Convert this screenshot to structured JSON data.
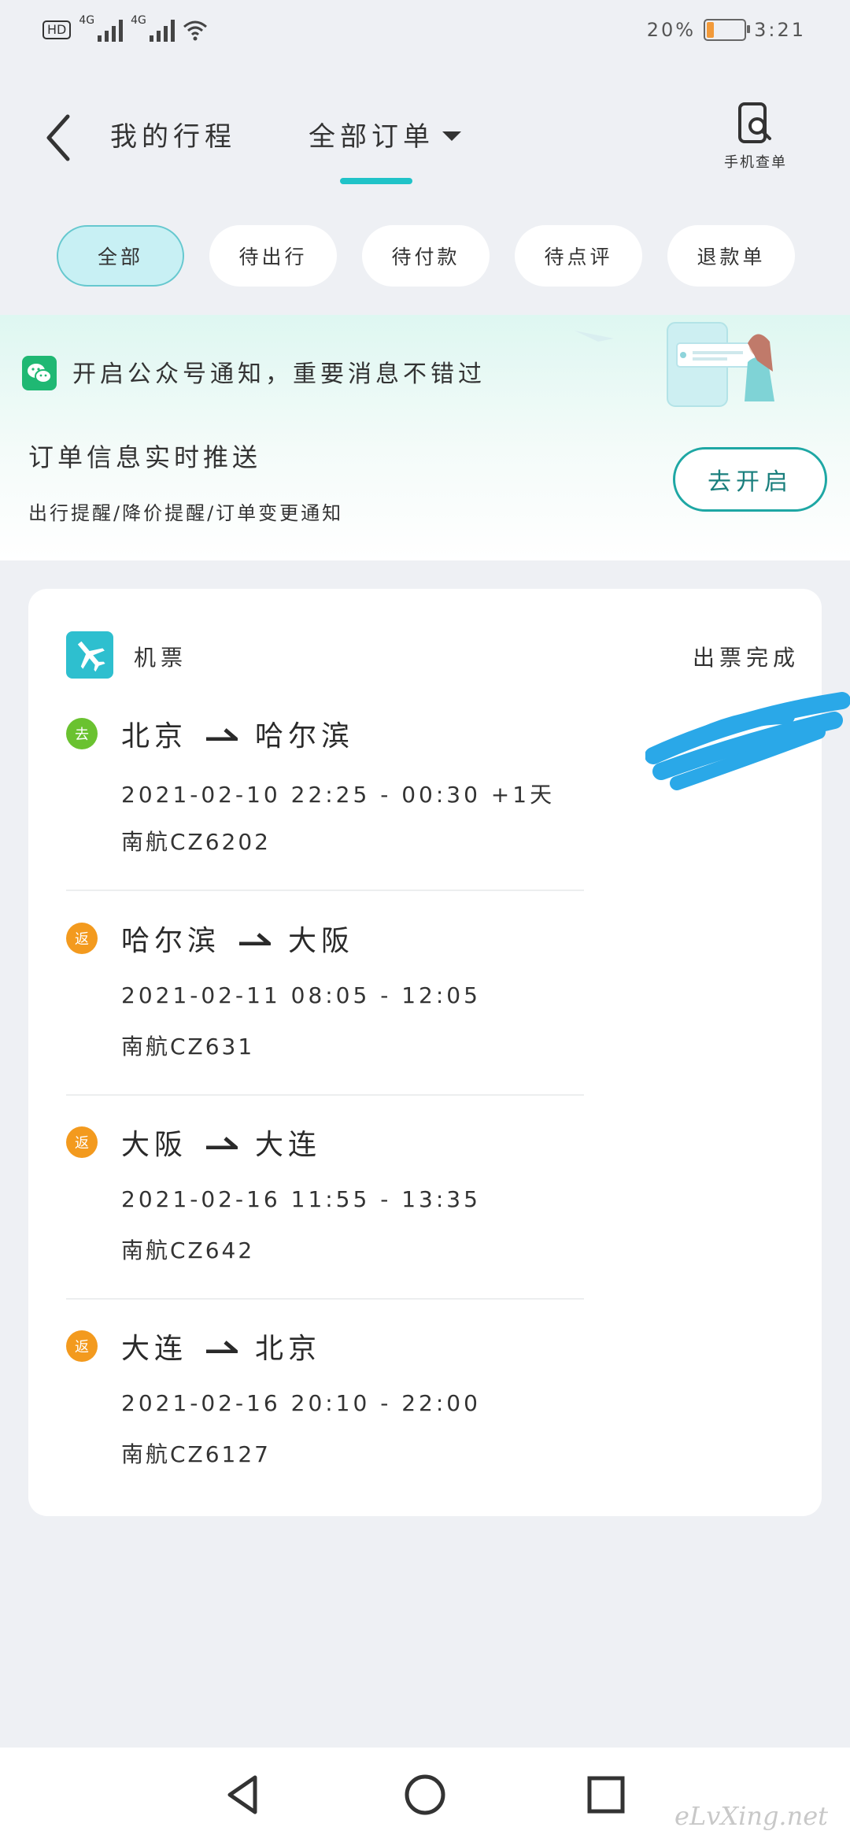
{
  "status_bar": {
    "hd_label": "HD",
    "network_1": "4G",
    "network_2": "4G",
    "battery": "20%",
    "battery_level": 0.2,
    "battery_color": "#f29a3a",
    "time": "3:21"
  },
  "header": {
    "back_icon": "chevron-left-icon",
    "title": "我的行程",
    "dropdown_label": "全部订单",
    "phone_search_label": "手机查单",
    "accent_color": "#20c3c8"
  },
  "filters": [
    {
      "label": "全部",
      "active": true
    },
    {
      "label": "待出行",
      "active": false
    },
    {
      "label": "待付款",
      "active": false
    },
    {
      "label": "待点评",
      "active": false
    },
    {
      "label": "退款单",
      "active": false
    }
  ],
  "banner": {
    "notice": "开启公众号通知，重要消息不错过",
    "title": "订单信息实时推送",
    "subtitle": "出行提醒/降价提醒/订单变更通知",
    "button_label": "去开启"
  },
  "order": {
    "type_label": "机票",
    "status": "出票完成",
    "segments": [
      {
        "badge": "去",
        "from": "北京",
        "to": "哈尔滨",
        "time": "2021-02-10 22:25 - 00:30 +1天",
        "flight": "南航CZ6202"
      },
      {
        "badge": "返",
        "from": "哈尔滨",
        "to": "大阪",
        "time": "2021-02-11 08:05 - 12:05",
        "flight": "南航CZ631"
      },
      {
        "badge": "返",
        "from": "大阪",
        "to": "大连",
        "time": "2021-02-16 11:55 - 13:35",
        "flight": "南航CZ642"
      },
      {
        "badge": "返",
        "from": "大连",
        "to": "北京",
        "time": "2021-02-16 20:10 - 22:00",
        "flight": "南航CZ6127"
      }
    ]
  },
  "nav": {
    "back": "triangle-back-icon",
    "home": "circle-home-icon",
    "recents": "square-recents-icon"
  },
  "watermark": "eLvXing.net"
}
